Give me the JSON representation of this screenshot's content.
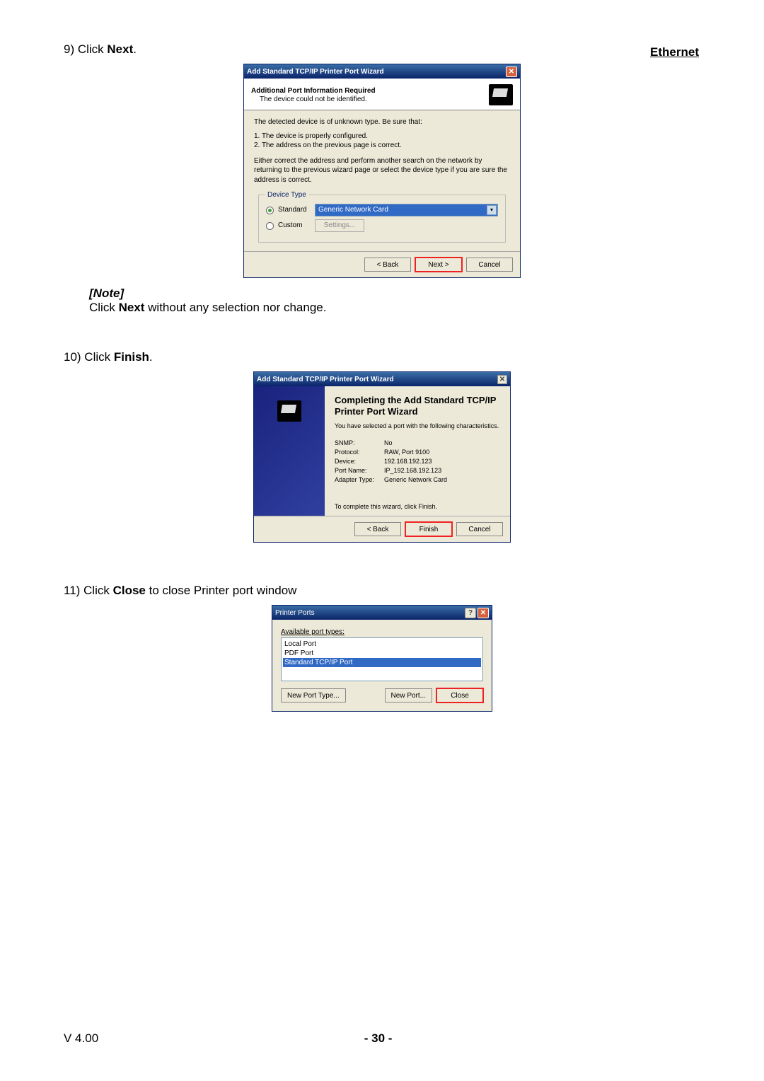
{
  "header": {
    "link": "Ethernet"
  },
  "step9": {
    "prefix": "9) Click ",
    "bold": "Next",
    "suffix": "."
  },
  "dialog1": {
    "title": "Add Standard TCP/IP Printer Port Wizard",
    "close": "✕",
    "h1": "Additional Port Information Required",
    "h2": "The device could not be identified.",
    "p1": "The detected device is of unknown type.  Be sure that:",
    "p2": "1.  The device is properly configured.",
    "p3": "2.  The address on the previous page is correct.",
    "p4": "Either correct the address and perform another search on the network by returning to the previous wizard page or select the device type if you are sure the address is correct.",
    "legend": "Device Type",
    "radio_standard": "Standard",
    "radio_custom": "Custom",
    "dropdown_value": "Generic Network Card",
    "settings_btn": "Settings...",
    "back": "< Back",
    "next": "Next >",
    "cancel": "Cancel"
  },
  "note": {
    "label": "[Note]",
    "prefix": "  Click ",
    "bold": "Next",
    "suffix": " without any selection nor change."
  },
  "step10": {
    "prefix": "10) Click ",
    "bold": "Finish",
    "suffix": "."
  },
  "dialog2": {
    "title": "Add Standard TCP/IP Printer Port Wizard",
    "close": "✕",
    "big": "Completing the Add Standard TCP/IP Printer Port Wizard",
    "intro": "You have selected a port with the following characteristics.",
    "rows": [
      {
        "k": "SNMP:",
        "v": "No"
      },
      {
        "k": "Protocol:",
        "v": "RAW, Port 9100"
      },
      {
        "k": "Device:",
        "v": "192.168.192.123"
      },
      {
        "k": "Port Name:",
        "v": "IP_192.168.192.123"
      },
      {
        "k": "Adapter Type:",
        "v": "Generic Network Card"
      }
    ],
    "complete": "To complete this wizard, click Finish.",
    "back": "< Back",
    "finish": "Finish",
    "cancel": "Cancel"
  },
  "step11": {
    "prefix": "11) Click ",
    "bold": "Close",
    "suffix": " to close Printer port window"
  },
  "dialog3": {
    "title": "Printer Ports",
    "help": "?",
    "close": "✕",
    "label": "Available port types:",
    "items": [
      "Local Port",
      "PDF Port",
      "Standard TCP/IP Port"
    ],
    "new_port_type": "New Port Type...",
    "new_port": "New Port...",
    "close_btn": "Close"
  },
  "footer": {
    "version": "V 4.00",
    "page": "- 30 -"
  }
}
